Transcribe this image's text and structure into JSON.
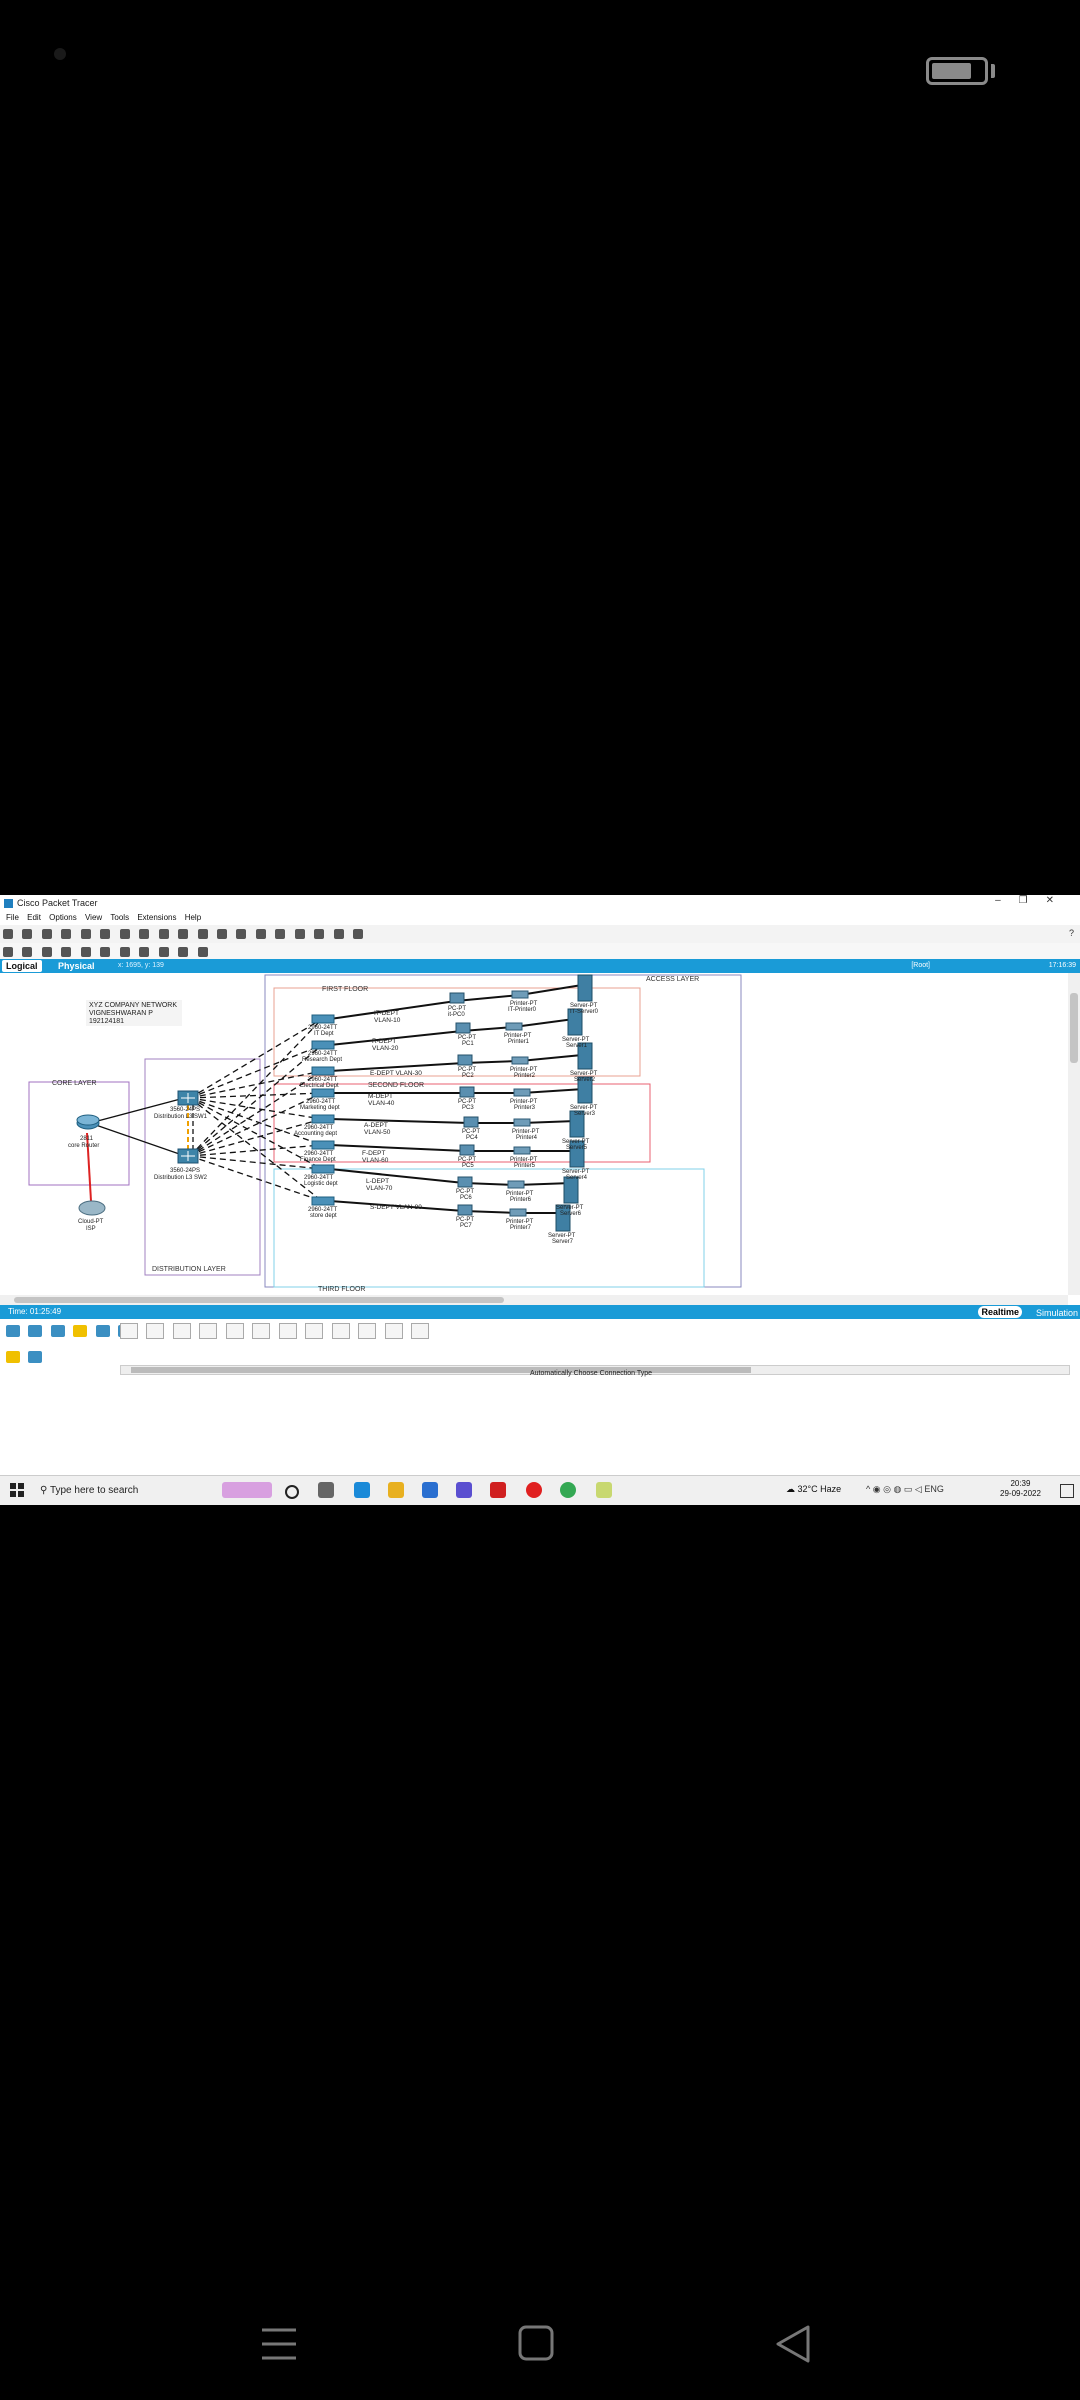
{
  "window": {
    "title": "Cisco Packet Tracer",
    "controls": [
      "–",
      "❐",
      "✕"
    ]
  },
  "menu": [
    "File",
    "Edit",
    "Options",
    "View",
    "Tools",
    "Extensions",
    "Help"
  ],
  "help_mark": "?",
  "mode": {
    "logical": "Logical",
    "physical": "Physical",
    "coords": "x: 1695, y: 139",
    "root": "[Root]",
    "clock": "17:16:39"
  },
  "statusbar": {
    "time": "Time: 01:25:49",
    "realtime": "Realtime",
    "simulation": "Simulation"
  },
  "connection_label": "Automatically Choose Connection Type",
  "network": {
    "title_lines": [
      "XYZ COMPANY NETWORK",
      "VIGNESHWARAN P",
      "192124181"
    ],
    "layers": {
      "core": "CORE LAYER",
      "distribution": "DISTRIBUTION LAYER",
      "access": "ACCESS LAYER"
    },
    "floors": [
      "FIRST FLOOR",
      "SECOND FLOOR",
      "THIRD FLOOR"
    ],
    "core_router": [
      "2811",
      "core Router"
    ],
    "isp": [
      "Cloud-PT",
      "ISP"
    ],
    "dist_sw1": [
      "3560-24PS",
      "Distribution L3 SW1"
    ],
    "dist_sw2": [
      "3560-24PS",
      "Distribution L3 SW2"
    ],
    "access_switches": [
      {
        "model": "2960-24TT",
        "name": "IT Dept"
      },
      {
        "model": "2960-24TT",
        "name": "Research Dept"
      },
      {
        "model": "2960-24TT",
        "name": "Electrical Dept"
      },
      {
        "model": "2960-24TT",
        "name": "Marketing dept"
      },
      {
        "model": "2960-24TT",
        "name": "Accounting dept"
      },
      {
        "model": "2960-24TT",
        "name": "Finance Dept"
      },
      {
        "model": "2960-24TT",
        "name": "Logistic dept"
      },
      {
        "model": "2960-24TT",
        "name": "store dept"
      }
    ],
    "vlans": [
      [
        "IT-DEPT",
        "VLAN-10"
      ],
      [
        "R-DEPT",
        "VLAN-20"
      ],
      [
        "E-DEPT VLAN-30"
      ],
      [
        "M-DEPT",
        "VLAN-40"
      ],
      [
        "A-DEPT",
        "VLAN-50"
      ],
      [
        "F-DEPT",
        "VLAN-60"
      ],
      [
        "L-DEPT",
        "VLAN-70"
      ],
      [
        "S-DEPT VLAN-80"
      ]
    ],
    "pcs": [
      [
        "PC-PT",
        "it-PC0"
      ],
      [
        "PC-PT",
        "PC1"
      ],
      [
        "PC-PT",
        "PC2"
      ],
      [
        "PC-PT",
        "PC3"
      ],
      [
        "PC-PT",
        "PC4"
      ],
      [
        "PC-PT",
        "PC5"
      ],
      [
        "PC-PT",
        "PC6"
      ],
      [
        "PC-PT",
        "PC7"
      ]
    ],
    "printers": [
      [
        "Printer-PT",
        "IT-Printer0"
      ],
      [
        "Printer-PT",
        "Printer1"
      ],
      [
        "Printer-PT",
        "Printer2"
      ],
      [
        "Printer-PT",
        "Printer3"
      ],
      [
        "Printer-PT",
        "Printer4"
      ],
      [
        "Printer-PT",
        "Printer5"
      ],
      [
        "Printer-PT",
        "Printer6"
      ],
      [
        "Printer-PT",
        "Printer7"
      ]
    ],
    "servers": [
      [
        "Server-PT",
        "IT-Server0"
      ],
      [
        "Server-PT",
        "Server1"
      ],
      [
        "Server-PT",
        "Server2"
      ],
      [
        "Server-PT",
        "Server3"
      ],
      [
        "Server-PT",
        "Server5"
      ],
      [
        "Server-PT",
        "Server4"
      ],
      [
        "Server-PT",
        "Server6"
      ],
      [
        "Server-PT",
        "Server7"
      ]
    ]
  },
  "taskbar": {
    "search_placeholder": "Type here to search",
    "weather": "32°C Haze",
    "lang": "ENG",
    "time": "20:39",
    "date": "29-09-2022"
  }
}
